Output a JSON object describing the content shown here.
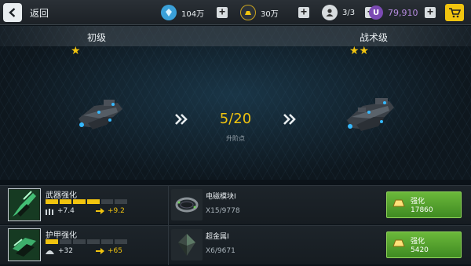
{
  "topbar": {
    "back_label": "返回",
    "resources": [
      {
        "icon": "crystal-icon",
        "value": "104万"
      },
      {
        "icon": "gold-bar-icon",
        "value": "30万"
      },
      {
        "icon": "pilot-icon",
        "value": "3/3"
      },
      {
        "icon": "premium-currency-icon",
        "value": "79,910"
      }
    ],
    "plus_label": "+"
  },
  "grades": {
    "current": {
      "label": "初级",
      "stars": "★"
    },
    "next": {
      "label": "战术级",
      "stars": "★★"
    }
  },
  "progress": {
    "text": "5/20",
    "label": "升阶点"
  },
  "rows": [
    {
      "title": "武器强化",
      "level_filled": 4,
      "level_total": 6,
      "stat_current": "+7.4",
      "stat_next": "+9.2",
      "material_name": "电磁模块Ⅰ",
      "material_count": "X15/9778",
      "button_label": "强化",
      "button_cost": "17860"
    },
    {
      "title": "护甲强化",
      "level_filled": 1,
      "level_total": 6,
      "stat_current": "+32",
      "stat_next": "+65",
      "material_name": "超金属Ⅰ",
      "material_count": "X6/9671",
      "button_label": "强化",
      "button_cost": "5420"
    }
  ],
  "colors": {
    "accent": "#f1c40f",
    "button": "#4f9c2b"
  }
}
